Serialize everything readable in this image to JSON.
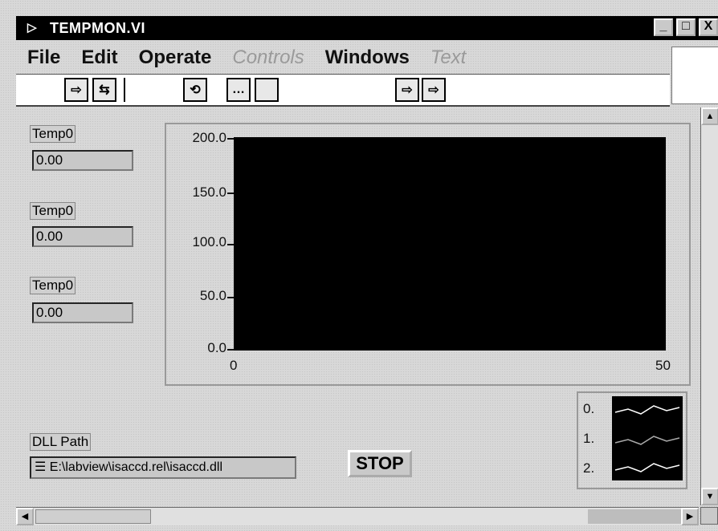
{
  "window": {
    "title": "TEMPMON.VI",
    "buttons": {
      "minimize": "_",
      "maximize": "□",
      "close": "X"
    }
  },
  "menu": {
    "items": [
      {
        "label": "File",
        "enabled": true
      },
      {
        "label": "Edit",
        "enabled": true
      },
      {
        "label": "Operate",
        "enabled": true
      },
      {
        "label": "Controls",
        "enabled": false
      },
      {
        "label": "Windows",
        "enabled": true
      },
      {
        "label": "Text",
        "enabled": false
      }
    ]
  },
  "toolbar": {
    "icons": [
      "run-icon",
      "run-continuous-icon",
      "abort-icon",
      "pause-icon",
      "step-icon",
      "step-into-icon",
      "step-over-icon"
    ]
  },
  "indicators": [
    {
      "label": "Temp0",
      "value": "0.00"
    },
    {
      "label": "Temp0",
      "value": "0.00"
    },
    {
      "label": "Temp0",
      "value": "0.00"
    }
  ],
  "chart_data": {
    "type": "line",
    "title": "",
    "xlabel": "",
    "ylabel": "",
    "xlim": [
      0,
      50
    ],
    "ylim": [
      0,
      200
    ],
    "y_ticks": [
      "200.0",
      "150.0",
      "100.0",
      "50.0",
      "0.0"
    ],
    "x_ticks": [
      "0",
      "50"
    ],
    "series": [],
    "background": "#000000"
  },
  "legend": {
    "entries": [
      "0.",
      "1.",
      "2."
    ],
    "colors": [
      "#ffffff",
      "#aaaaaa",
      "#ffffff"
    ]
  },
  "dll_path": {
    "label": "DLL Path",
    "value": "E:\\labview\\isaccd.rel\\isaccd.dll"
  },
  "stop_button": {
    "label": "STOP"
  }
}
